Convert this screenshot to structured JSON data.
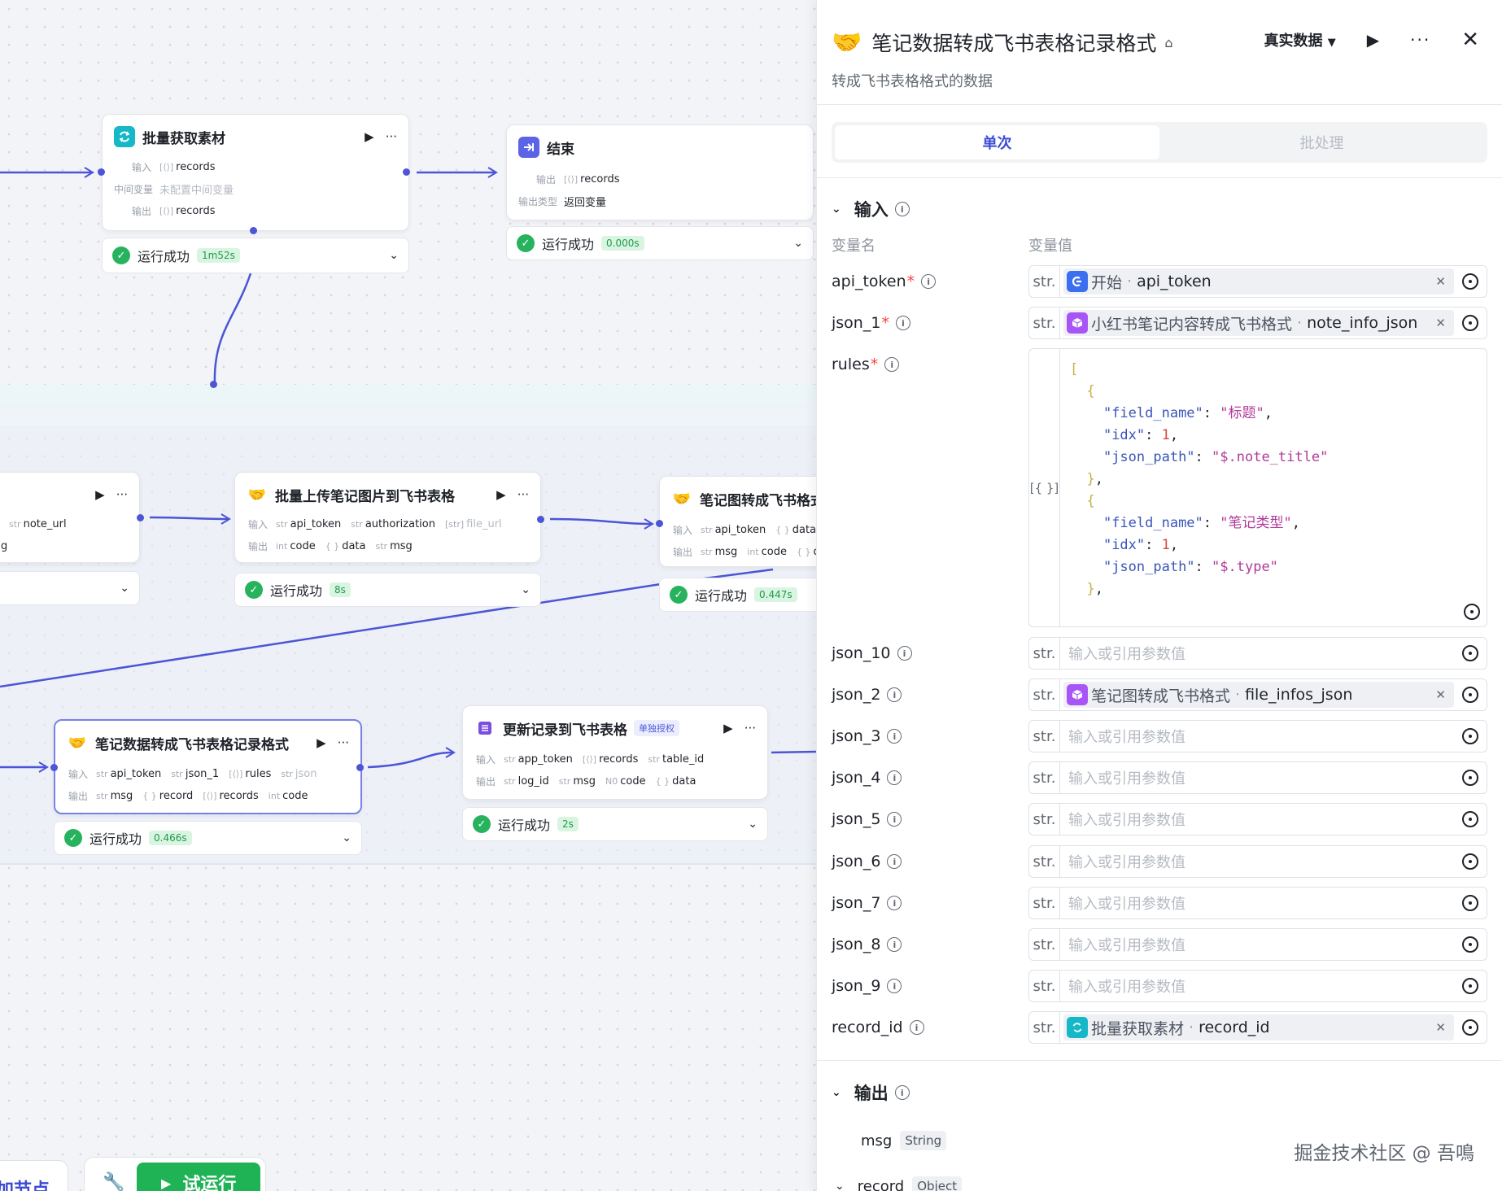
{
  "canvas": {
    "nodes": {
      "batch_fetch": {
        "title": "批量获取素材",
        "input_label": "输入",
        "mid_label": "中间变量",
        "output_label": "输出",
        "input": [
          {
            "type": "[⟨⟩]",
            "name": "records"
          }
        ],
        "mid_value": "未配置中间变量",
        "output": [
          {
            "type": "[⟨⟩]",
            "name": "records"
          }
        ],
        "status": "运行成功",
        "time": "1m52s"
      },
      "end": {
        "title": "结束",
        "output_label": "输出",
        "type_label": "输出类型",
        "output": [
          {
            "type": "[⟨⟩]",
            "name": "records"
          }
        ],
        "type_value": "返回变量",
        "status": "运行成功",
        "time": "0.000s"
      },
      "partial_left": {
        "input": [
          {
            "type": "str",
            "name": "note_url"
          }
        ],
        "output_frag": "g"
      },
      "upload_images": {
        "title": "批量上传笔记图片到飞书表格",
        "input_label": "输入",
        "output_label": "输出",
        "input": [
          {
            "type": "str",
            "name": "api_token"
          },
          {
            "type": "str",
            "name": "authorization"
          },
          {
            "type": "[str]",
            "name": "file_url"
          }
        ],
        "output": [
          {
            "type": "int",
            "name": "code"
          },
          {
            "type": "{ }",
            "name": "data"
          },
          {
            "type": "str",
            "name": "msg"
          }
        ],
        "status": "运行成功",
        "time": "8s"
      },
      "note_image_convert": {
        "title": "笔记图转成飞书格式",
        "input_label": "输入",
        "output_label": "输出",
        "input": [
          {
            "type": "str",
            "name": "api_token"
          },
          {
            "type": "{ }",
            "name": "data"
          }
        ],
        "output": [
          {
            "type": "str",
            "name": "msg"
          },
          {
            "type": "int",
            "name": "code"
          },
          {
            "type": "{ }",
            "name": "d"
          }
        ],
        "status": "运行成功",
        "time": "0.447s"
      },
      "note_convert": {
        "title": "笔记数据转成飞书表格记录格式",
        "input_label": "输入",
        "output_label": "输出",
        "input": [
          {
            "type": "str",
            "name": "api_token"
          },
          {
            "type": "str",
            "name": "json_1"
          },
          {
            "type": "[⟨⟩]",
            "name": "rules"
          },
          {
            "type": "str",
            "name": "json"
          }
        ],
        "output": [
          {
            "type": "str",
            "name": "msg"
          },
          {
            "type": "{ }",
            "name": "record"
          },
          {
            "type": "[⟨⟩]",
            "name": "records"
          },
          {
            "type": "int",
            "name": "code"
          }
        ],
        "status": "运行成功",
        "time": "0.466s"
      },
      "update_record": {
        "title": "更新记录到飞书表格",
        "badge": "单独授权",
        "input_label": "输入",
        "output_label": "输出",
        "input": [
          {
            "type": "str",
            "name": "app_token"
          },
          {
            "type": "[⟨⟩]",
            "name": "records"
          },
          {
            "type": "str",
            "name": "table_id"
          }
        ],
        "output": [
          {
            "type": "str",
            "name": "log_id"
          },
          {
            "type": "str",
            "name": "msg"
          },
          {
            "type": "N0",
            "name": "code"
          },
          {
            "type": "{ }",
            "name": "data"
          }
        ],
        "status": "运行成功",
        "time": "2s"
      }
    },
    "toolbar": {
      "add_node_label": "加节点",
      "run_label": "试运行"
    }
  },
  "panel": {
    "title": "笔记数据转成飞书表格记录格式",
    "data_mode": "真实数据",
    "description": "转成飞书表格格式的数据",
    "tabs": [
      "单次",
      "批处理"
    ],
    "input_section": "输入",
    "col_name": "变量名",
    "col_value": "变量值",
    "placeholder": "输入或引用参数值",
    "type_str": "str.",
    "type_json": "[{ }]",
    "params": [
      {
        "name": "api_token",
        "required": "*",
        "ref_node": "开始",
        "ref_var": "api_token",
        "icon": "start"
      },
      {
        "name": "json_1",
        "required": "*",
        "ref_node": "小红书笔记内容转成飞书格式",
        "ref_var": "note_info_json",
        "icon": "plugin"
      },
      {
        "name": "rules",
        "required": "*"
      },
      {
        "name": "json_10"
      },
      {
        "name": "json_2",
        "ref_node": "笔记图转成飞书格式",
        "ref_var": "file_infos_json",
        "icon": "plugin"
      },
      {
        "name": "json_3"
      },
      {
        "name": "json_4"
      },
      {
        "name": "json_5"
      },
      {
        "name": "json_6"
      },
      {
        "name": "json_7"
      },
      {
        "name": "json_8"
      },
      {
        "name": "json_9"
      },
      {
        "name": "record_id",
        "ref_node": "批量获取素材",
        "ref_var": "record_id",
        "icon": "loop"
      }
    ],
    "rules_code": [
      {
        "field_name": "标题",
        "idx": 1,
        "json_path": "$.note_title"
      },
      {
        "field_name": "笔记类型",
        "idx": 1,
        "json_path": "$.type"
      }
    ],
    "output_section": "输出",
    "outputs": [
      {
        "name": "msg",
        "type": "String"
      },
      {
        "name": "record",
        "type": "Object"
      }
    ],
    "watermark": "掘金技术社区 @ 吾鳴"
  },
  "colors": {
    "accent": "#3c4bd6",
    "edge": "#4b55d6",
    "success": "#27b35d",
    "run_button": "#1fb355"
  }
}
